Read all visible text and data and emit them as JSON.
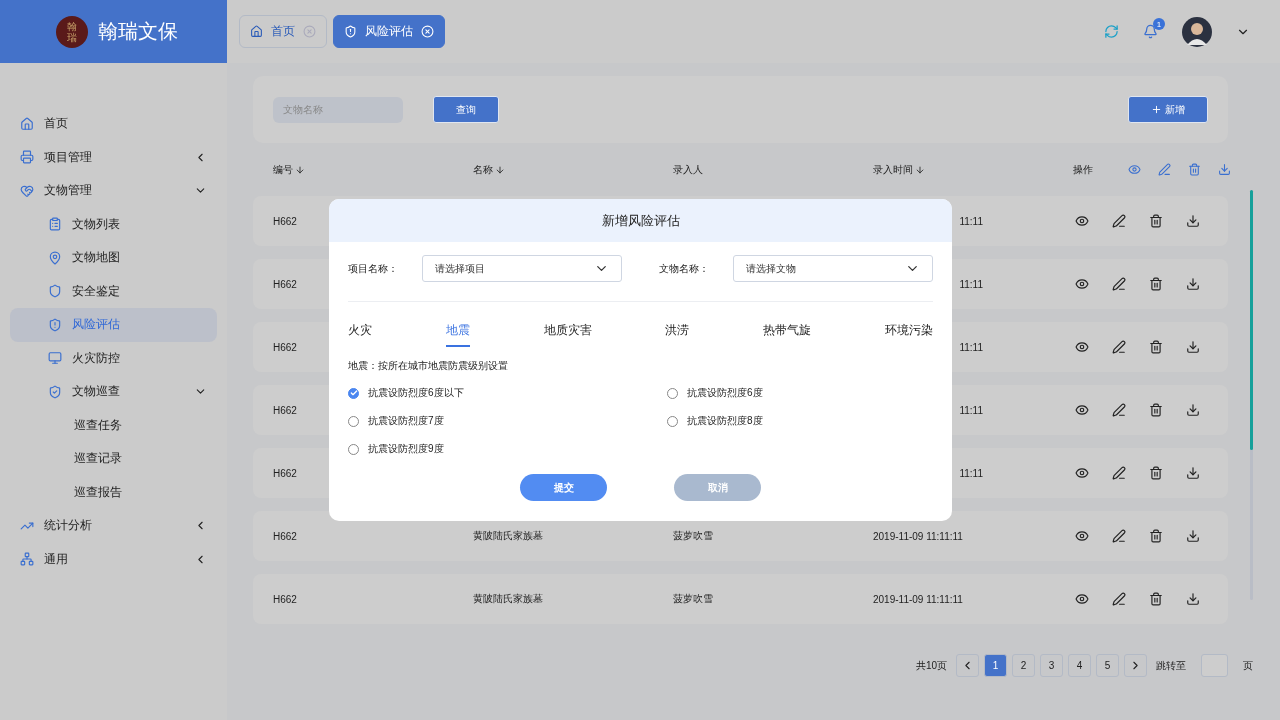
{
  "brand": {
    "name": "翰瑞文保",
    "seal": "翰瑞"
  },
  "open_tabs": [
    {
      "label": "首页",
      "selected": false
    },
    {
      "label": "风险评估",
      "selected": true
    }
  ],
  "header": {
    "notification_count": "1"
  },
  "sidebar": {
    "items": [
      {
        "label": "首页",
        "selected": false
      },
      {
        "label": "项目管理",
        "selected": false,
        "expanded": false
      },
      {
        "label": "文物管理",
        "selected": false,
        "expanded": true,
        "children": [
          {
            "label": "文物列表",
            "selected": false
          },
          {
            "label": "文物地图",
            "selected": false
          },
          {
            "label": "安全鉴定",
            "selected": false
          },
          {
            "label": "风险评估",
            "selected": true
          },
          {
            "label": "火灾防控",
            "selected": false
          },
          {
            "label": "文物巡查",
            "selected": false,
            "expanded": true,
            "children": [
              {
                "label": "巡查任务",
                "selected": false
              },
              {
                "label": "巡查记录",
                "selected": false
              },
              {
                "label": "巡查报告",
                "selected": false
              }
            ]
          }
        ]
      },
      {
        "label": "统计分析",
        "selected": false,
        "expanded": false
      },
      {
        "label": "通用",
        "selected": false,
        "expanded": false
      }
    ]
  },
  "toolbar": {
    "search": {
      "placeholder": "文物名称"
    },
    "query_button": "查询",
    "add_button": "新增"
  },
  "table": {
    "columns": [
      {
        "label": "编号",
        "sortable": true
      },
      {
        "label": "名称",
        "sortable": true
      },
      {
        "label": "录入人",
        "sortable": false
      },
      {
        "label": "录入时间",
        "sortable": true
      },
      {
        "label": "操作",
        "sortable": false
      }
    ],
    "rows": [
      {
        "kind": "covered",
        "code": "H662",
        "time": "11:11"
      },
      {
        "kind": "covered",
        "code": "H662",
        "time": "11:11"
      },
      {
        "kind": "covered",
        "code": "H662",
        "time": "11:11"
      },
      {
        "kind": "covered",
        "code": "H662",
        "time": "11:11"
      },
      {
        "kind": "covered",
        "code": "H662",
        "time": "11:11"
      },
      {
        "kind": "full",
        "code": "H662",
        "name": "黄陂陆氏家族墓",
        "person": "菠萝吹雪",
        "time": "2019-11-09 11:11:11"
      },
      {
        "kind": "full",
        "code": "H662",
        "name": "黄陂陆氏家族墓",
        "person": "菠萝吹雪",
        "time": "2019-11-09 11:11:11"
      }
    ]
  },
  "pagination": {
    "total": "共10页",
    "pages": [
      {
        "label": "1",
        "selected": true
      },
      {
        "label": "2",
        "selected": false
      },
      {
        "label": "3",
        "selected": false
      },
      {
        "label": "4",
        "selected": false
      },
      {
        "label": "5",
        "selected": false
      }
    ],
    "jump_label": "跳转至",
    "unit": "页"
  },
  "modal": {
    "title": "新增风险评估",
    "fields": [
      {
        "label": "项目名称：",
        "placeholder": "请选择项目"
      },
      {
        "label": "文物名称：",
        "placeholder": "请选择文物"
      }
    ],
    "hazard_tabs": [
      {
        "label": "火灾",
        "selected": false
      },
      {
        "label": "地震",
        "selected": true
      },
      {
        "label": "地质灾害",
        "selected": false
      },
      {
        "label": "洪涝",
        "selected": false
      },
      {
        "label": "热带气旋",
        "selected": false
      },
      {
        "label": "环境污染",
        "selected": false
      }
    ],
    "note": "地震：按所在城市地震防震级别设置",
    "options": [
      {
        "label": "抗震设防烈度6度以下",
        "selected": true
      },
      {
        "label": "抗震设防烈度6度",
        "selected": false
      },
      {
        "label": "抗震设防烈度7度",
        "selected": false
      },
      {
        "label": "抗震设防烈度8度",
        "selected": false
      },
      {
        "label": "抗震设防烈度9度",
        "selected": false
      }
    ],
    "buttons": [
      {
        "kind": "primary",
        "label": "提交"
      },
      {
        "kind": "secondary",
        "label": "取消"
      }
    ]
  }
}
